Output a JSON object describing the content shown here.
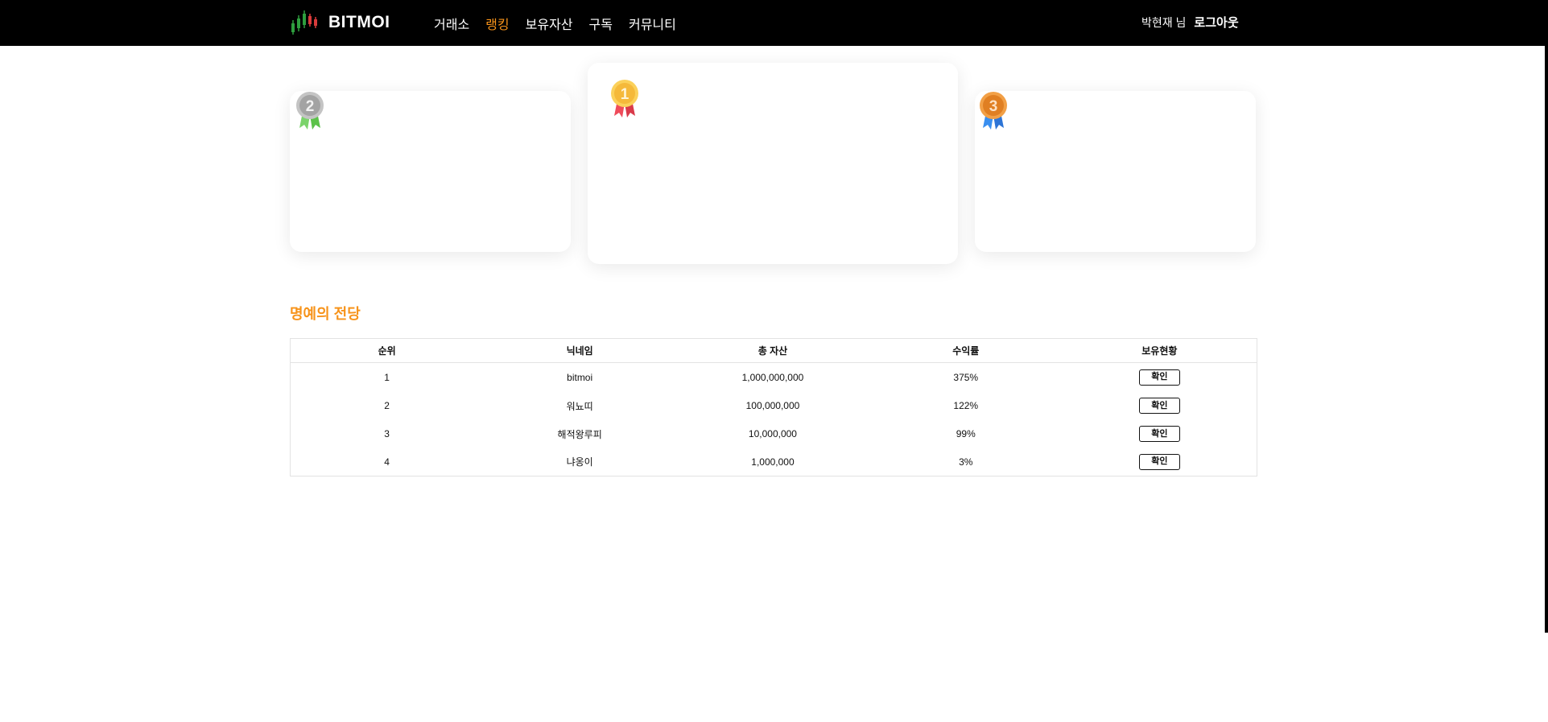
{
  "colors": {
    "accent": "#f7931a",
    "navbar": "#000000",
    "gold": "#f5c342",
    "silver": "#a9a9a9",
    "bronze": "#e88a2d"
  },
  "header": {
    "brand": "BITMOI",
    "menu": [
      {
        "label": "거래소",
        "active": false
      },
      {
        "label": "랭킹",
        "active": true
      },
      {
        "label": "보유자산",
        "active": false
      },
      {
        "label": "구독",
        "active": false
      },
      {
        "label": "커뮤니티",
        "active": false
      }
    ],
    "user_label": "박현재 님",
    "logout_label": "로그아웃"
  },
  "podium": [
    {
      "rank": "2",
      "medal": "silver-medal-icon"
    },
    {
      "rank": "1",
      "medal": "gold-medal-icon"
    },
    {
      "rank": "3",
      "medal": "bronze-medal-icon"
    }
  ],
  "hall_of_fame": {
    "title": "명예의 전당",
    "columns": [
      "순위",
      "닉네임",
      "총 자산",
      "수익률",
      "보유현황"
    ],
    "rows": [
      {
        "rank": "1",
        "nickname": "bitmoi",
        "total": "1,000,000,000",
        "yield": "375%",
        "action": "확인"
      },
      {
        "rank": "2",
        "nickname": "워뇨띠",
        "total": "100,000,000",
        "yield": "122%",
        "action": "확인"
      },
      {
        "rank": "3",
        "nickname": "해적왕루피",
        "total": "10,000,000",
        "yield": "99%",
        "action": "확인"
      },
      {
        "rank": "4",
        "nickname": "냐옹이",
        "total": "1,000,000",
        "yield": "3%",
        "action": "확인"
      }
    ]
  }
}
